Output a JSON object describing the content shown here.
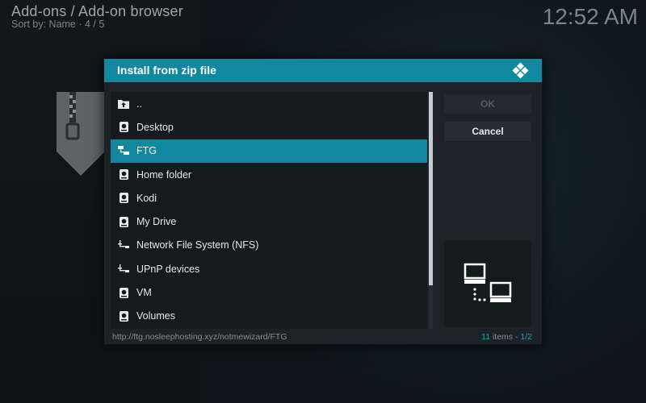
{
  "header": {
    "title": "Add-ons / Add-on browser",
    "subtitle": "Sort by: Name  ·  4 / 5",
    "clock": "12:52 AM"
  },
  "dialog": {
    "title": "Install from zip file",
    "items": [
      {
        "label": "..",
        "icon": "folder-up-icon"
      },
      {
        "label": "Desktop",
        "icon": "drive-icon"
      },
      {
        "label": "FTG",
        "icon": "network-share-icon",
        "selected": true
      },
      {
        "label": "Home folder",
        "icon": "drive-icon"
      },
      {
        "label": "Kodi",
        "icon": "drive-icon"
      },
      {
        "label": "My Drive",
        "icon": "drive-icon"
      },
      {
        "label": "Network File System (NFS)",
        "icon": "network-icon"
      },
      {
        "label": "UPnP devices",
        "icon": "network-icon"
      },
      {
        "label": "VM",
        "icon": "drive-icon"
      },
      {
        "label": "Volumes",
        "icon": "drive-icon"
      }
    ],
    "buttons": {
      "ok_label": "OK",
      "cancel_label": "Cancel"
    },
    "footer": {
      "path": "http://ftg.nosleephosting.xyz/notmewizard/FTG",
      "items_count": "11",
      "items_suffix": " items - ",
      "page": "1/2"
    }
  },
  "colors": {
    "accent": "#12889f",
    "dialog_bg": "#1c2226",
    "list_bg": "#151a1d"
  }
}
